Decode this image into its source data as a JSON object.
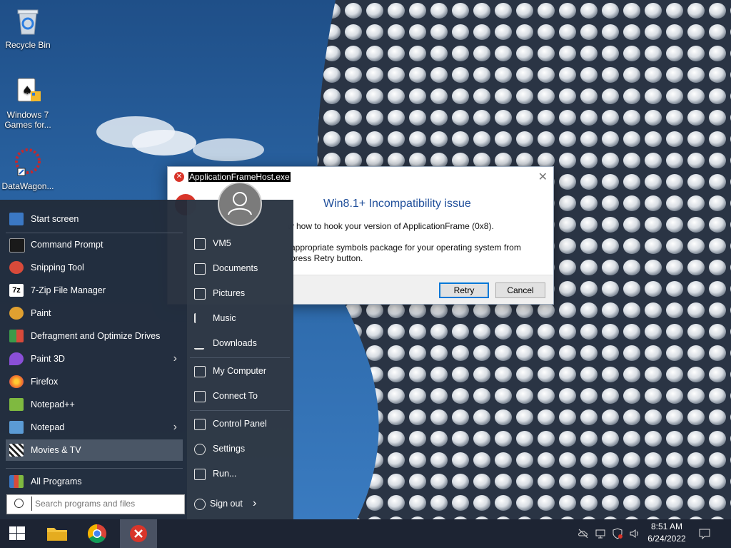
{
  "desktop": {
    "icons": [
      {
        "label": "Recycle Bin"
      },
      {
        "label": "Windows 7 Games for..."
      },
      {
        "label": "DataWagon..."
      }
    ]
  },
  "dialog": {
    "title": "ApplicationFrameHost.exe",
    "heading_visible": "Win8.1+ Incompatibility issue",
    "message1": "w how to hook your version of ApplicationFrame (0x8).",
    "message2_line1": "appropriate symbols package for your operating system from",
    "message2_line2": "press Retry button.",
    "retry_label": "Retry",
    "cancel_label": "Cancel",
    "close_glyph": "✕"
  },
  "start_menu": {
    "programs": [
      {
        "label": "Start screen",
        "icon": "start-screen-icon",
        "color": "#3b78c4"
      },
      {
        "label": "Command Prompt",
        "icon": "command-prompt-icon",
        "color": "#1a1a1a"
      },
      {
        "label": "Snipping Tool",
        "icon": "snipping-tool-icon",
        "color": "#d84a3a"
      },
      {
        "label": "7-Zip File Manager",
        "icon": "7zip-icon",
        "color": "#111111"
      },
      {
        "label": "Paint",
        "icon": "paint-icon",
        "color": "#e0a030"
      },
      {
        "label": "Defragment and Optimize Drives",
        "icon": "defragment-icon",
        "color": "#3c9a4a"
      },
      {
        "label": "Paint 3D",
        "icon": "paint3d-icon",
        "color": "#8a4fd8",
        "arrow": "›"
      },
      {
        "label": "Firefox",
        "icon": "firefox-icon",
        "color": "#f0762a"
      },
      {
        "label": "Notepad++",
        "icon": "notepadpp-icon",
        "color": "#7fb940"
      },
      {
        "label": "Notepad",
        "icon": "notepad-icon",
        "color": "#5b9bd5",
        "arrow": "›"
      },
      {
        "label": "Movies & TV",
        "icon": "movies-tv-icon",
        "color": "#444444"
      }
    ],
    "all_programs": "All Programs",
    "search_placeholder": "Search programs and files",
    "places": [
      {
        "label": "VM5",
        "icon": "user-folder-icon"
      },
      {
        "label": "Documents",
        "icon": "documents-icon"
      },
      {
        "label": "Pictures",
        "icon": "pictures-icon"
      },
      {
        "label": "Music",
        "icon": "music-icon"
      },
      {
        "label": "Downloads",
        "icon": "downloads-icon"
      },
      {
        "label": "My Computer",
        "icon": "computer-icon"
      },
      {
        "label": "Connect To",
        "icon": "connect-to-icon"
      },
      {
        "label": "Control Panel",
        "icon": "control-panel-icon"
      },
      {
        "label": "Settings",
        "icon": "settings-gear-icon"
      },
      {
        "label": "Run...",
        "icon": "run-icon"
      }
    ],
    "sign_out": "Sign out",
    "sign_out_arrow": "›"
  },
  "taskbar": {
    "time": "8:51 AM",
    "date": "6/24/2022"
  }
}
